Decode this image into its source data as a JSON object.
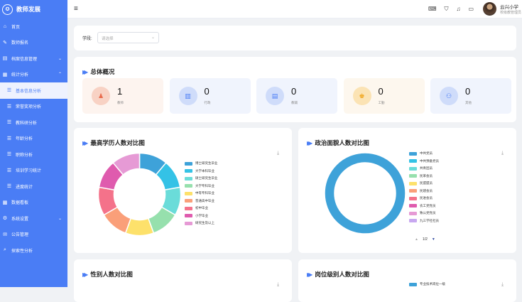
{
  "app": {
    "title": "教师发展",
    "logo_icon": "graduation-icon"
  },
  "sidebar": {
    "items": [
      {
        "label": "首页",
        "icon": "home-icon",
        "glyph": "⌂",
        "level": 0
      },
      {
        "label": "数师报名",
        "icon": "signup-icon",
        "glyph": "✎",
        "level": 0
      },
      {
        "label": "档案信息管理",
        "icon": "archive-icon",
        "glyph": "▤",
        "level": 0,
        "arrow": "⌄"
      },
      {
        "label": "统计分析",
        "icon": "chart-icon",
        "glyph": "▦",
        "level": 0,
        "arrow": "⌃"
      },
      {
        "label": "基本信息分析",
        "icon": "list-icon",
        "glyph": "☰",
        "level": 1,
        "active": true
      },
      {
        "label": "荣誉奖项分析",
        "icon": "list-icon",
        "glyph": "☰",
        "level": 1
      },
      {
        "label": "教科研分析",
        "icon": "list-icon",
        "glyph": "☰",
        "level": 1
      },
      {
        "label": "年龄分析",
        "icon": "list-icon",
        "glyph": "☰",
        "level": 1
      },
      {
        "label": "职称分析",
        "icon": "list-icon",
        "glyph": "☰",
        "level": 1
      },
      {
        "label": "培训学习统计",
        "icon": "list-icon",
        "glyph": "☰",
        "level": 1
      },
      {
        "label": "进度统计",
        "icon": "list-icon",
        "glyph": "☰",
        "level": 1
      },
      {
        "label": "数据看板",
        "icon": "dashboard-icon",
        "glyph": "▩",
        "level": 0
      },
      {
        "label": "系统设置",
        "icon": "settings-icon",
        "glyph": "⚙",
        "level": 0,
        "arrow": "⌄"
      },
      {
        "label": "公告管理",
        "icon": "notice-icon",
        "glyph": "✉",
        "level": 0
      },
      {
        "label": "探索性分析",
        "icon": "explore-icon",
        "glyph": "⌕",
        "level": 0
      }
    ]
  },
  "topbar": {
    "menu_icon": "≡",
    "icons": [
      {
        "name": "keyboard-icon",
        "glyph": "⌨"
      },
      {
        "name": "shirt-icon",
        "glyph": "⛉"
      },
      {
        "name": "bell-icon",
        "glyph": "♫"
      },
      {
        "name": "card-icon",
        "glyph": "▭"
      }
    ],
    "user_name": "云兴小学",
    "user_role": "校级教管理员"
  },
  "filter": {
    "label": "学段:",
    "placeholder": "请选择",
    "chevron": "⌄"
  },
  "overview": {
    "title": "总体概况",
    "stats": [
      {
        "value": "1",
        "label": "教师",
        "icon": "teacher-icon",
        "glyph": "♟",
        "bg": "#fdf4ef",
        "circle": "#f8d2c4",
        "color": "#e8694a"
      },
      {
        "value": "0",
        "label": "行政",
        "icon": "admin-icon",
        "glyph": "▥",
        "bg": "#f0f4fd",
        "circle": "#cfdcfa",
        "color": "#4a7df5"
      },
      {
        "value": "0",
        "label": "教辅",
        "icon": "assistant-icon",
        "glyph": "▤",
        "bg": "#f0f4fd",
        "circle": "#cfdcfa",
        "color": "#4a7df5"
      },
      {
        "value": "0",
        "label": "工勤",
        "icon": "worker-icon",
        "glyph": "♚",
        "bg": "#fdf7ee",
        "circle": "#fbe3b4",
        "color": "#f0a51c"
      },
      {
        "value": "0",
        "label": "其他",
        "icon": "other-icon",
        "glyph": "⚇",
        "bg": "#f0f4fd",
        "circle": "#cfdcfa",
        "color": "#4a7df5"
      }
    ]
  },
  "edu_chart": {
    "title": "最高学历人数对比图",
    "download_icon": "⤓"
  },
  "pol_chart": {
    "title": "政治面貌人数对比图",
    "download_icon": "⤓"
  },
  "gender_chart": {
    "title": "性别人数对比图",
    "download_icon": "⤓"
  },
  "post_chart": {
    "title": "岗位级别人数对比图",
    "download_icon": "⤓"
  },
  "chart_data": [
    {
      "type": "pie",
      "title": "最高学历人数对比图",
      "categories": [
        "博士研究生毕业",
        "大学本科毕业",
        "硕士研究生毕业",
        "大学专科毕业",
        "中等专科毕业",
        "普通高中毕业",
        "初中毕业",
        "小学毕业",
        "研究生及以上"
      ],
      "colors": [
        "#3ea2d9",
        "#34c2e6",
        "#6adcd9",
        "#96e0ad",
        "#fde16b",
        "#fa9f79",
        "#f4728a",
        "#df5bae",
        "#e69ad5"
      ],
      "values": [
        1,
        1,
        1,
        1,
        1,
        1,
        1,
        1,
        1
      ]
    },
    {
      "type": "pie",
      "title": "政治面貌人数对比图",
      "categories": [
        "中共党员",
        "中共预备党员",
        "共青团员",
        "民革会员",
        "民盟盟员",
        "民建会员",
        "民进会员",
        "农工党党员",
        "致公党党员",
        "九三学社社员"
      ],
      "colors": [
        "#3ea2d9",
        "#34c2e6",
        "#6adcd9",
        "#96e0ad",
        "#fde16b",
        "#fa9f79",
        "#f4728a",
        "#df5bae",
        "#e69ad5",
        "#c8a8f0"
      ],
      "values": [
        1,
        0,
        0,
        0,
        0,
        0,
        0,
        0,
        0,
        0
      ],
      "legend_page": "1/2",
      "legend_prev": "▲",
      "legend_next": "▼"
    },
    {
      "type": "pie",
      "title": "性别人数对比图",
      "categories": [],
      "values": []
    },
    {
      "type": "pie",
      "title": "岗位级别人数对比图",
      "categories": [
        "专业技术岗位一级"
      ],
      "colors": [
        "#3ea2d9"
      ],
      "values": []
    }
  ]
}
